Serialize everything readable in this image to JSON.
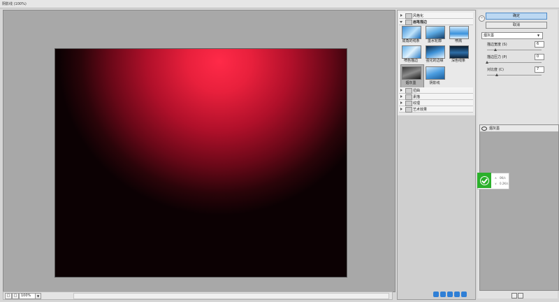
{
  "window": {
    "title": "阴影线 (100%)"
  },
  "status_bar": {
    "minus": "□",
    "plus": "□",
    "zoom": "100%"
  },
  "gallery": {
    "categories": [
      {
        "label": "风格化",
        "open": false
      },
      {
        "label": "画笔描边",
        "open": true
      },
      {
        "label": "扭曲",
        "open": false
      },
      {
        "label": "素描",
        "open": false
      },
      {
        "label": "纹理",
        "open": false
      },
      {
        "label": "艺术效果",
        "open": false
      }
    ],
    "thumbs": [
      {
        "label": "成角的线条"
      },
      {
        "label": "墨水轮廓"
      },
      {
        "label": "喷溅"
      },
      {
        "label": "喷色描边"
      },
      {
        "label": "强化的边缘"
      },
      {
        "label": "深色线条"
      },
      {
        "label": "烟灰墨"
      },
      {
        "label": "阴影线"
      }
    ]
  },
  "right_panel": {
    "ok": "确定",
    "cancel": "取消",
    "filter_selected": "烟灰墨",
    "params": [
      {
        "label": "描边宽度 (S)",
        "value": "6",
        "fraction": 0.15
      },
      {
        "label": "描边压力 (P)",
        "value": "0",
        "fraction": 0.0
      },
      {
        "label": "对比度 (C)",
        "value": "7",
        "fraction": 0.18
      }
    ],
    "layer_name": "烟灰墨"
  },
  "overlay": {
    "line1": "0K/s",
    "line2": "0.2K/s"
  },
  "colors": {
    "ok_button": "#bcd8f2",
    "badge": "#2bb02b"
  }
}
